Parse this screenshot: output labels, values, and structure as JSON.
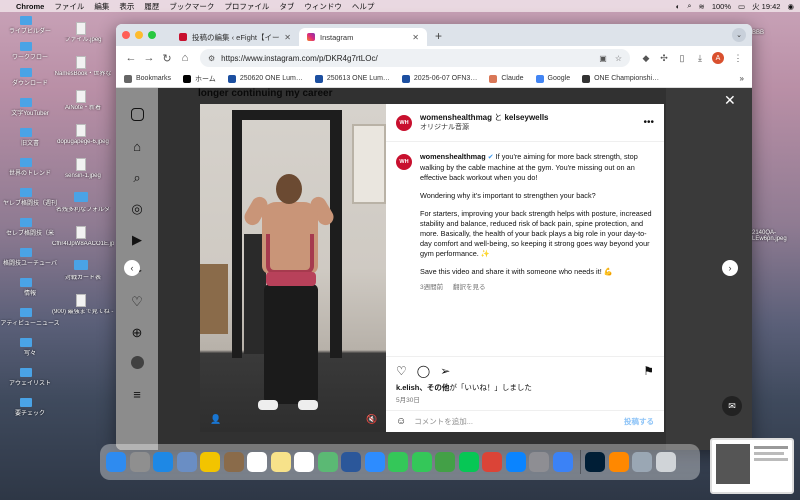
{
  "menubar": {
    "app": "Chrome",
    "items": [
      "ファイル",
      "編集",
      "表示",
      "履歴",
      "ブックマーク",
      "プロファイル",
      "タブ",
      "ウィンドウ",
      "ヘルプ"
    ],
    "battery": "100%",
    "datetime": "火 19:42"
  },
  "desktop_left": [
    {
      "label": "ライブビルダー"
    },
    {
      "label": "ワークフロー"
    },
    {
      "label": "ダウンロード"
    },
    {
      "label": "文字YouTuber"
    },
    {
      "label": "旧文書"
    },
    {
      "label": "世界のトレンド"
    },
    {
      "label": "ヤレブ格闘技（週刊"
    },
    {
      "label": "セレブ格闘技（米"
    },
    {
      "label": "格闘技ユーチューバ"
    },
    {
      "label": "情報"
    },
    {
      "label": "アティビューニュース"
    },
    {
      "label": "写々"
    },
    {
      "label": "アウェイリスト"
    },
    {
      "label": "要チェック"
    }
  ],
  "desktop_left2": [
    {
      "label": "ファイル.jpeg"
    },
    {
      "label": "NamesBook・世界な"
    },
    {
      "label": "AiNote・新着"
    },
    {
      "label": "dopugapege-6.jpeg"
    },
    {
      "label": "sensin-1.jpeg"
    },
    {
      "label": "名残多利なフォルダ"
    },
    {
      "label": "Cfhr4IJpW8AACO1E.jpeg"
    },
    {
      "label": "対戦カード表"
    },
    {
      "label": "(900) 最強まで見てね - YouTube"
    }
  ],
  "desktop_right": [
    {
      "label": "BBB"
    },
    {
      "label": "2140QA-LEw6pn.jpeg"
    }
  ],
  "browser": {
    "tabs": [
      {
        "title": "投稿の編集 ‹ eFight【イーファイト】",
        "active": false,
        "favicon_color": "#c8102e"
      },
      {
        "title": "Instagram",
        "active": true,
        "favicon_color": "#e1306c"
      }
    ],
    "new_tab": "+",
    "url": "https://www.instagram.com/p/DKR4g7rtLOc/",
    "profile_initial": "A",
    "bookmarks": [
      {
        "label": "Bookmarks",
        "color": "#666"
      },
      {
        "label": "ホーム",
        "color": "#000"
      },
      {
        "label": "250620 ONE Lum…",
        "color": "#1c4fa0"
      },
      {
        "label": "250613 ONE Lum…",
        "color": "#1c4fa0"
      },
      {
        "label": "2025-06-07 OFN3…",
        "color": "#1c4fa0"
      },
      {
        "label": "Claude",
        "color": "#d97757"
      },
      {
        "label": "Google",
        "color": "#4285f4"
      },
      {
        "label": "ONE Championshi…",
        "color": "#333"
      }
    ],
    "bookmarks_more": "»"
  },
  "instagram": {
    "bg_caption": "longer continuing my career",
    "post": {
      "avatar_text": "WH",
      "author": "womenshealthmag",
      "and": " と ",
      "coauthor": "kelseywells",
      "audio": "オリジナル音源",
      "caption_user": "womenshealthmag",
      "caption_p1": "If you're aiming for more back strength, stop walking by the cable machine at the gym. You're missing out on an effective back workout when you do!",
      "caption_p2": "Wondering why it's important to strengthen your back?",
      "caption_p3": "For starters, improving your back strength helps with posture, increased stability and balance, reduced risk of back pain, spine protection, and more. Basically, the health of your back plays a big role in your day-to-day comfort and well-being, so keeping it strong goes way beyond your gym performance. ✨",
      "caption_p4": "Save this video and share it with someone who needs it! 💪",
      "time_ago": "3週間前",
      "translate": "翻訳を見る",
      "likes_user": "k.elish、その他",
      "likes_suffix": "が「いいね！」しました",
      "date": "5月30日",
      "comment_placeholder": "コメントを追加...",
      "post_label": "投稿する"
    }
  },
  "colors": {
    "accent_blue": "#3897f0",
    "wh_red": "#c8102e",
    "post_button_disabled": "#8cc3f7"
  },
  "dock": [
    {
      "name": "finder",
      "color": "#2e8bf0"
    },
    {
      "name": "launchpad",
      "color": "#8f8f8f"
    },
    {
      "name": "safari",
      "color": "#1e88e5"
    },
    {
      "name": "photos-app",
      "color": "#6a8ec4"
    },
    {
      "name": "chrome",
      "color": "#f2c400"
    },
    {
      "name": "notes-brown",
      "color": "#8a6b4a"
    },
    {
      "name": "calendar",
      "color": "#ffffff"
    },
    {
      "name": "notes",
      "color": "#f7e28a"
    },
    {
      "name": "reminders",
      "color": "#ffffff"
    },
    {
      "name": "maps",
      "color": "#5bb974"
    },
    {
      "name": "word",
      "color": "#2b579a"
    },
    {
      "name": "zoom",
      "color": "#2d8cff"
    },
    {
      "name": "facetime",
      "color": "#34c759"
    },
    {
      "name": "messages",
      "color": "#34c759"
    },
    {
      "name": "numbers",
      "color": "#43a047"
    },
    {
      "name": "line",
      "color": "#06c755"
    },
    {
      "name": "chrome-2",
      "color": "#db4437"
    },
    {
      "name": "app-store",
      "color": "#0a84ff"
    },
    {
      "name": "settings",
      "color": "#8e8e93"
    },
    {
      "name": "mail",
      "color": "#3b82f6"
    },
    {
      "name": "photoshop",
      "color": "#001e36"
    },
    {
      "name": "vlc",
      "color": "#ff8800"
    },
    {
      "name": "preview",
      "color": "#9aa7b4"
    },
    {
      "name": "trash",
      "color": "#d0d4d8"
    }
  ]
}
